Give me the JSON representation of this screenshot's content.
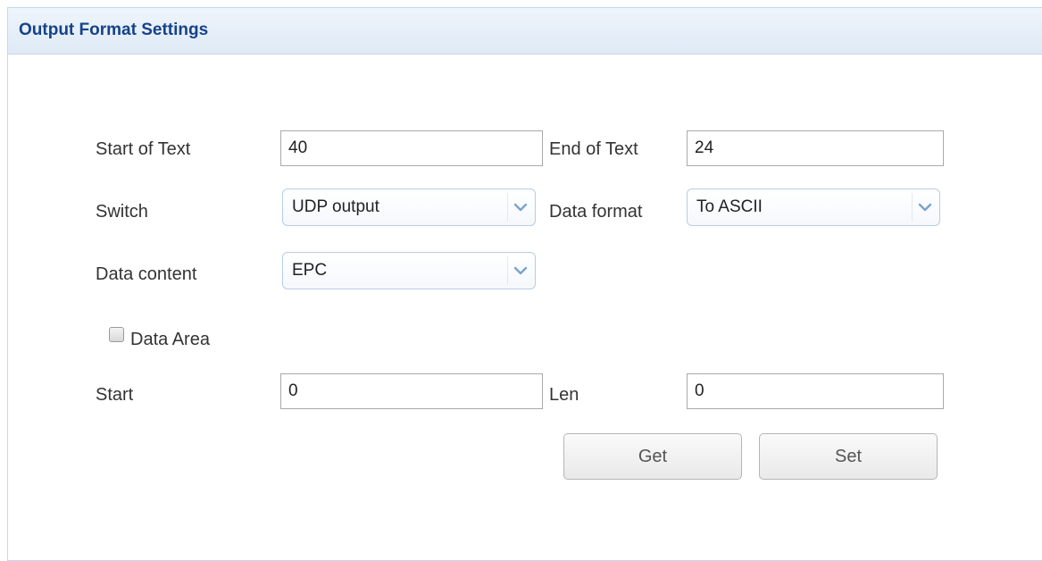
{
  "panel": {
    "title": "Output Format Settings"
  },
  "form": {
    "start_of_text": {
      "label": "Start of Text",
      "value": "40"
    },
    "end_of_text": {
      "label": "End of Text",
      "value": "24"
    },
    "switch": {
      "label": "Switch",
      "selected": "UDP output"
    },
    "data_format": {
      "label": "Data format",
      "selected": "To ASCII"
    },
    "data_content": {
      "label": "Data content",
      "selected": "EPC"
    },
    "data_area": {
      "label": "Data Area",
      "checked": false
    },
    "start": {
      "label": "Start",
      "value": "0"
    },
    "len": {
      "label": "Len",
      "value": "0"
    }
  },
  "buttons": {
    "get_label": "Get",
    "set_label": "Set"
  },
  "icons": {
    "dropdown": "chevron-down-icon",
    "checkbox": "checkbox-unchecked"
  },
  "colors": {
    "header_text": "#15428b",
    "header_bg": "#dfeaf6",
    "border": "#c5d7ea",
    "chevron": "#7aa3cf"
  }
}
